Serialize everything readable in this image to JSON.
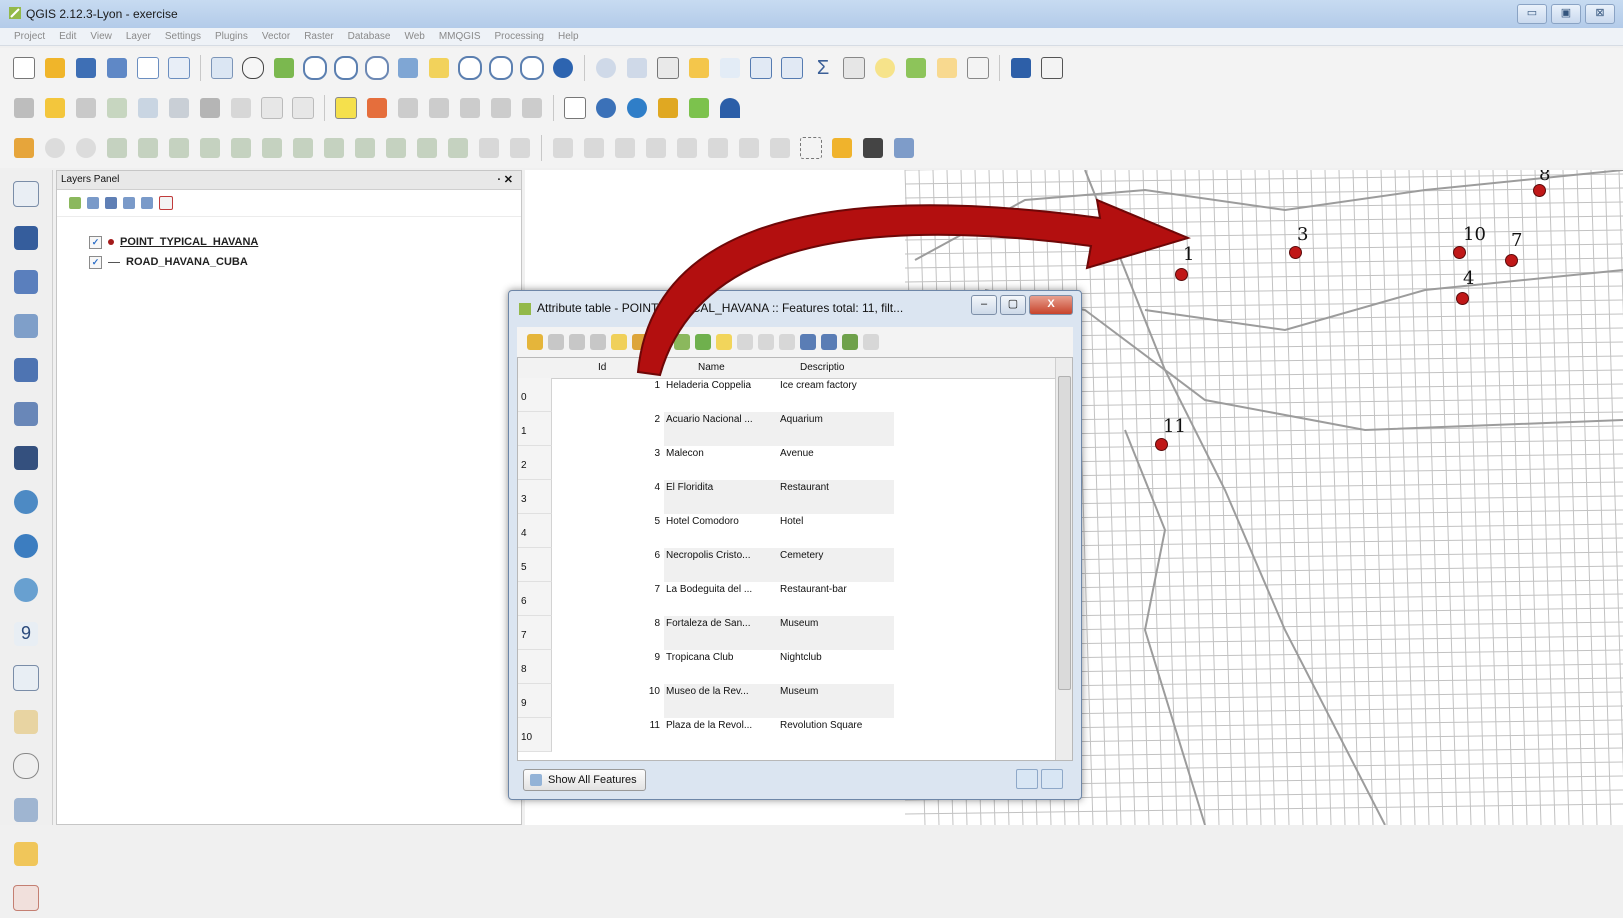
{
  "window": {
    "title": "QGIS 2.12.3-Lyon - exercise",
    "buttons": [
      "▭",
      "▣",
      "⊠"
    ]
  },
  "menu": [
    "Project",
    "Edit",
    "View",
    "Layer",
    "Settings",
    "Plugins",
    "Vector",
    "Raster",
    "Database",
    "Web",
    "MMQGIS",
    "Processing",
    "Help"
  ],
  "layers_panel": {
    "title": "Layers Panel",
    "controls": "· ✕",
    "layers": [
      {
        "name": "POINT_TYPICAL_HAVANA",
        "checked": true,
        "symbol": "point"
      },
      {
        "name": "ROAD_HAVANA_CUBA",
        "checked": true,
        "symbol": "line"
      }
    ]
  },
  "map": {
    "point_labels": [
      "1",
      "3",
      "4",
      "7",
      "8",
      "10",
      "11"
    ]
  },
  "attribute_table": {
    "title": "Attribute table - POINT_TYPICAL_HAVANA :: Features total: 11, filt...",
    "close_label": "X",
    "columns": [
      "Id",
      "Name",
      "Descriptio"
    ],
    "rows": [
      {
        "row": "0",
        "id": "1",
        "name": "Heladeria Coppelia",
        "desc": "Ice cream factory"
      },
      {
        "row": "1",
        "id": "2",
        "name": "Acuario Nacional ...",
        "desc": "Aquarium"
      },
      {
        "row": "2",
        "id": "3",
        "name": "Malecon",
        "desc": "Avenue"
      },
      {
        "row": "3",
        "id": "4",
        "name": "El Floridita",
        "desc": "Restaurant"
      },
      {
        "row": "4",
        "id": "5",
        "name": "Hotel Comodoro",
        "desc": "Hotel"
      },
      {
        "row": "5",
        "id": "6",
        "name": "Necropolis Cristo...",
        "desc": "Cemetery"
      },
      {
        "row": "6",
        "id": "7",
        "name": "La Bodeguita del ...",
        "desc": "Restaurant-bar"
      },
      {
        "row": "7",
        "id": "8",
        "name": "Fortaleza de San...",
        "desc": "Museum"
      },
      {
        "row": "8",
        "id": "9",
        "name": "Tropicana Club",
        "desc": "Nightclub"
      },
      {
        "row": "9",
        "id": "10",
        "name": "Museo de la Rev...",
        "desc": "Museum"
      },
      {
        "row": "10",
        "id": "11",
        "name": "Plaza de la Revol...",
        "desc": "Revolution Square"
      }
    ],
    "show_all_label": "Show All Features"
  },
  "colors": {
    "point": "#c01818",
    "arrow": "#b30f0f",
    "roads": "#bdbdbd"
  }
}
